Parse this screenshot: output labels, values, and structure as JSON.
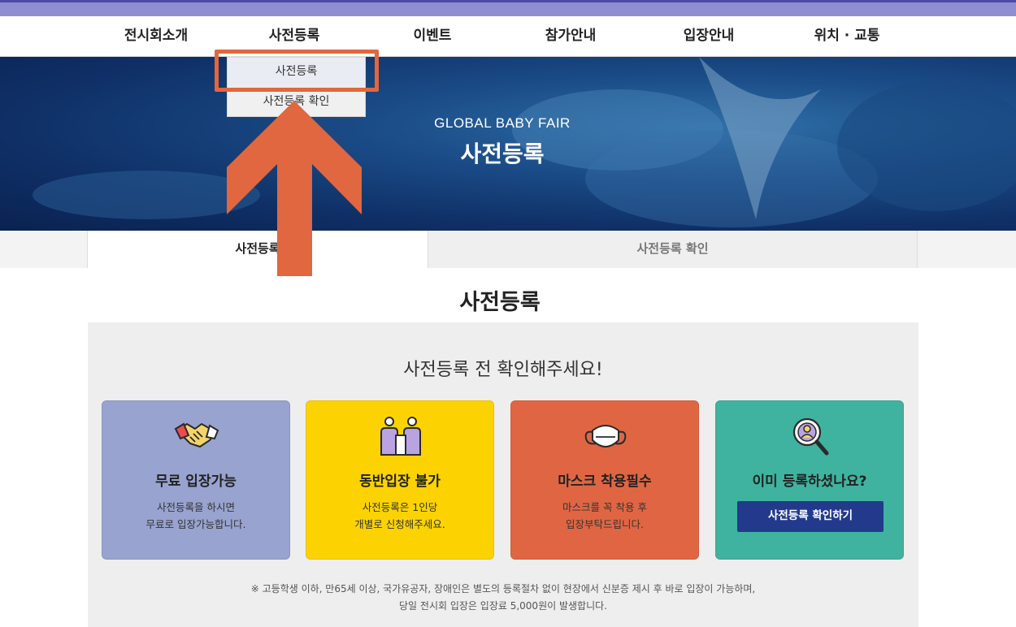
{
  "nav": {
    "items": [
      "전시회소개",
      "사전등록",
      "이벤트",
      "참가안내",
      "입장안내",
      "위치 · 교통"
    ]
  },
  "dropdown": {
    "items": [
      "사전등록",
      "사전등록 확인"
    ]
  },
  "hero": {
    "subtitle": "GLOBAL BABY FAIR",
    "title": "사전등록"
  },
  "subtabs": {
    "active": "사전등록",
    "inactive": "사전등록 확인"
  },
  "page_title": "사전등록",
  "panel": {
    "title": "사전등록 전 확인해주세요!",
    "cards": [
      {
        "icon": "handshake-icon",
        "color": "#98a3cf",
        "title": "무료 입장가능",
        "desc": [
          "사전등록을 하시면",
          "무료로 입장가능합니다."
        ]
      },
      {
        "icon": "two-people-icon",
        "color": "#fcd300",
        "title": "동반입장 불가",
        "desc": [
          "사전등록은 1인당",
          "개별로 신청해주세요."
        ]
      },
      {
        "icon": "mask-icon",
        "color": "#e06643",
        "title": "마스크 착용필수",
        "desc": [
          "마스크를 꼭 착용 후",
          "입장부탁드립니다."
        ]
      },
      {
        "icon": "search-person-icon",
        "color": "#3fb39f",
        "title": "이미 등록하셨나요?",
        "button": "사전등록 확인하기"
      }
    ],
    "notice": [
      "※ 고등학생 이하, 만65세 이상, 국가유공자, 장애인은 별도의 등록절차 없이 현장에서 신분증 제시 후 바로 입장이 가능하며,",
      "당일 전시회 입장은 입장료 5,000원이 발생합니다."
    ]
  },
  "colors": {
    "accent_annotation": "#e0673f",
    "button_navy": "#233a8c",
    "topbar": "#8e8ed0"
  }
}
